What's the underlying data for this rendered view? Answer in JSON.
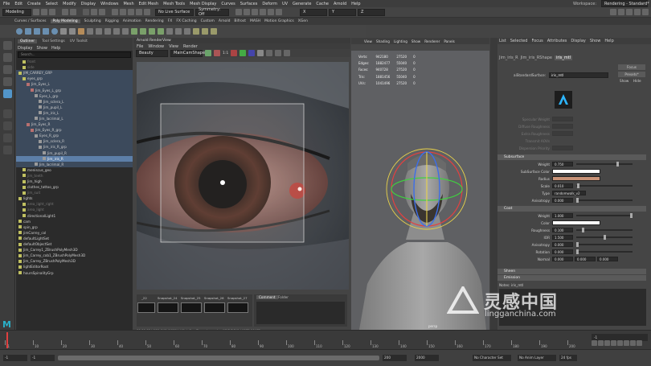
{
  "menubar": {
    "items": [
      "File",
      "Edit",
      "Create",
      "Select",
      "Modify",
      "Display",
      "Windows",
      "Mesh",
      "Edit Mesh",
      "Mesh Tools",
      "Mesh Display",
      "Curves",
      "Surfaces",
      "Deform",
      "UV",
      "Generate",
      "Cache",
      "Arnold",
      "Help"
    ],
    "workspace_label": "Workspace:",
    "workspace_value": "Rendering - Standard*"
  },
  "statusline": {
    "mode": "Modeling",
    "live_surface": "No Live Surface",
    "symmetry": "Symmetry: Off"
  },
  "shelf_tabs": [
    "Curves / Surfaces",
    "Poly Modeling",
    "Sculpting",
    "Rigging",
    "Animation",
    "Rendering",
    "FX",
    "FX Caching",
    "Custom",
    "Arnold",
    "Bifrost",
    "MASH",
    "Motion Graphics",
    "XGen"
  ],
  "outliner": {
    "tabs": [
      "Outliner",
      "Tool Settings",
      "UV Toolkit"
    ],
    "menu": [
      "Display",
      "Show",
      "Help"
    ],
    "search_placeholder": "Search...",
    "items": [
      {
        "label": "front",
        "depth": 1,
        "state": "dim"
      },
      {
        "label": "side",
        "depth": 1,
        "state": "dim"
      },
      {
        "label": "JIM_CARREY_GRP",
        "depth": 0,
        "state": "hl"
      },
      {
        "label": "eyes_grp",
        "depth": 1,
        "state": "hl"
      },
      {
        "label": "Jim_Eyes_L",
        "depth": 2,
        "state": "hl"
      },
      {
        "label": "Jim_Eyes_L_grp",
        "depth": 3,
        "state": "hl"
      },
      {
        "label": "Eyes_L_grp",
        "depth": 4,
        "state": "hl"
      },
      {
        "label": "Jim_sclera_L",
        "depth": 5,
        "state": "hl"
      },
      {
        "label": "Jim_pupil_L",
        "depth": 5,
        "state": "hl"
      },
      {
        "label": "Jim_iris_L",
        "depth": 5,
        "state": "hl"
      },
      {
        "label": "Jim_lacrimal_L",
        "depth": 4,
        "state": "hl"
      },
      {
        "label": "Jim_Eyes_R",
        "depth": 2,
        "state": "hl"
      },
      {
        "label": "Jim_Eyes_R_grp",
        "depth": 3,
        "state": "hl"
      },
      {
        "label": "Eyes_R_grp",
        "depth": 4,
        "state": "hl"
      },
      {
        "label": "Jim_sclera_R",
        "depth": 5,
        "state": "hl"
      },
      {
        "label": "Jim_iris_R_grp",
        "depth": 5,
        "state": "hl"
      },
      {
        "label": "Jim_pupil_R",
        "depth": 6,
        "state": "hl"
      },
      {
        "label": "Jim_iris_R",
        "depth": 6,
        "state": "sel"
      },
      {
        "label": "Jim_lacrimal_R",
        "depth": 4,
        "state": "hl"
      },
      {
        "label": "meniscus_geo",
        "depth": 1,
        "state": ""
      },
      {
        "label": "jim_teeth",
        "depth": 1,
        "state": "dim"
      },
      {
        "label": "Jim_high",
        "depth": 1,
        "state": ""
      },
      {
        "label": "clothes_tattoo_grp",
        "depth": 1,
        "state": ""
      },
      {
        "label": "jim_suit",
        "depth": 1,
        "state": "dim"
      },
      {
        "label": "lights",
        "depth": 0,
        "state": ""
      },
      {
        "label": "area_light_right",
        "depth": 1,
        "state": "dim"
      },
      {
        "label": "area_light",
        "depth": 1,
        "state": "dim"
      },
      {
        "label": "directionalLight1",
        "depth": 1,
        "state": ""
      },
      {
        "label": "cam",
        "depth": 0,
        "state": ""
      },
      {
        "label": "spin_grp",
        "depth": 0,
        "state": ""
      },
      {
        "label": "jimCarrey_col",
        "depth": 0,
        "state": ""
      },
      {
        "label": "defaultLightSet",
        "depth": 0,
        "state": ""
      },
      {
        "label": "defaultObjectSet",
        "depth": 0,
        "state": ""
      },
      {
        "label": "Jim_Carrey1_ZBrushPolyMesh3D",
        "depth": 0,
        "state": ""
      },
      {
        "label": "Jim_Carrey_cob1_ZBrushPolyMesh3D",
        "depth": 0,
        "state": ""
      },
      {
        "label": "Jim_Carrey_ZBrushPolyMesh3D",
        "depth": 0,
        "state": ""
      },
      {
        "label": "lightEditorRoot",
        "depth": 0,
        "state": ""
      },
      {
        "label": "hoursSpinalityGrp",
        "depth": 0,
        "state": ""
      }
    ]
  },
  "render_view": {
    "title": "Arnold RenderView",
    "menu": [
      "File",
      "Window",
      "View",
      "Render"
    ],
    "aov": "Beauty",
    "camera": "MainCamShape",
    "zoom": "1:1",
    "snapshots": [
      "_22",
      "Snapshot_24",
      "Snapshot_25",
      "Snapshot_26",
      "Snapshot_27"
    ],
    "comment_tabs": [
      "Comment",
      "Folder"
    ],
    "status": "00:00:05 | 960x540 (100%) | MainCamShape | samples 4/2/2/2/2/0 | 1572.96 MB"
  },
  "viewport": {
    "menu": [
      "View",
      "Shading",
      "Lighting",
      "Show",
      "Renderer",
      "Panels"
    ],
    "hud": [
      [
        "Verts:",
        "942180",
        "27520",
        "0"
      ],
      [
        "Edges:",
        "1882477",
        "55040",
        "0"
      ],
      [
        "Faces:",
        "940728",
        "27520",
        "0"
      ],
      [
        "Tris:",
        "1881456",
        "55040",
        "0"
      ],
      [
        "UVs:",
        "1041496",
        "27520",
        "0"
      ]
    ],
    "camera_label": "persp"
  },
  "attribute_editor": {
    "menu": [
      "List",
      "Selected",
      "Focus",
      "Attributes",
      "Display",
      "Show",
      "Help"
    ],
    "tabs": [
      "Jim_iris_R",
      "Jim_iris_RShape",
      "iris_mtl"
    ],
    "type_label": "aiStandardSurface:",
    "node_name": "iris_mtl",
    "buttons": {
      "focus": "Focus",
      "presets": "Presets*",
      "show": "Show",
      "hide": "Hide"
    },
    "faded_rows": [
      "Specular Weight",
      "Diffuse Roughness",
      "Extra Roughness",
      "Transmit AOVs",
      "Dispersion Priority"
    ],
    "subsurface": {
      "title": "Subsurface",
      "rows": [
        {
          "label": "Weight",
          "value": "0.750",
          "level": 0.75
        },
        {
          "label": "SubSurface Color",
          "value": "",
          "swatch": "#ffffff"
        },
        {
          "label": "Radius",
          "value": "",
          "swatch": "#c89277"
        },
        {
          "label": "Scale",
          "value": "0.010",
          "level": 0.01
        },
        {
          "label": "Type",
          "value": "randomwalk_v2"
        },
        {
          "label": "Anisotropy",
          "value": "0.000",
          "level": 0.0
        }
      ]
    },
    "coat": {
      "title": "Coat",
      "rows": [
        {
          "label": "Weight",
          "value": "1.000",
          "level": 1.0
        },
        {
          "label": "Color",
          "value": "",
          "swatch": "#ffffff"
        },
        {
          "label": "Roughness",
          "value": "0.100",
          "level": 0.1
        },
        {
          "label": "IOR",
          "value": "1.500",
          "level": 0.5
        },
        {
          "label": "Anisotropy",
          "value": "0.000",
          "level": 0.0
        },
        {
          "label": "Rotation",
          "value": "0.000",
          "level": 0.0
        },
        {
          "label": "Normal",
          "value": "0.000",
          "value2": "0.000",
          "value3": "0.000"
        }
      ]
    },
    "collapsed_sections": [
      "Sheen",
      "Emission"
    ],
    "notes_label": "Notes:",
    "notes_value": "iris_mtl"
  },
  "timeline": {
    "ticks": [
      "-1",
      "10",
      "20",
      "30",
      "40",
      "50",
      "60",
      "70",
      "80",
      "90",
      "100",
      "110",
      "120",
      "130",
      "140",
      "150",
      "160",
      "170",
      "180",
      "190",
      "200"
    ],
    "current_frame": "-1",
    "range_start": "-1",
    "range_start_inner": "-1",
    "range_end_inner": "200",
    "range_end": "2000",
    "character_set": "No Character Set",
    "anim_layer": "No Anim Layer",
    "fps": "24 fps"
  },
  "watermark": {
    "brand_cn": "灵感中国",
    "url": "lingganchina.com"
  },
  "colors": {
    "selection": "#5d7fa8",
    "highlight": "#3c4a5c",
    "manipulator_red": "#e34040",
    "manipulator_green": "#40d040",
    "manipulator_blue": "#3d6ee8",
    "arnold_logo_bg": "#1d1d1d",
    "arnold_logo_fg": "#2db6ff"
  }
}
